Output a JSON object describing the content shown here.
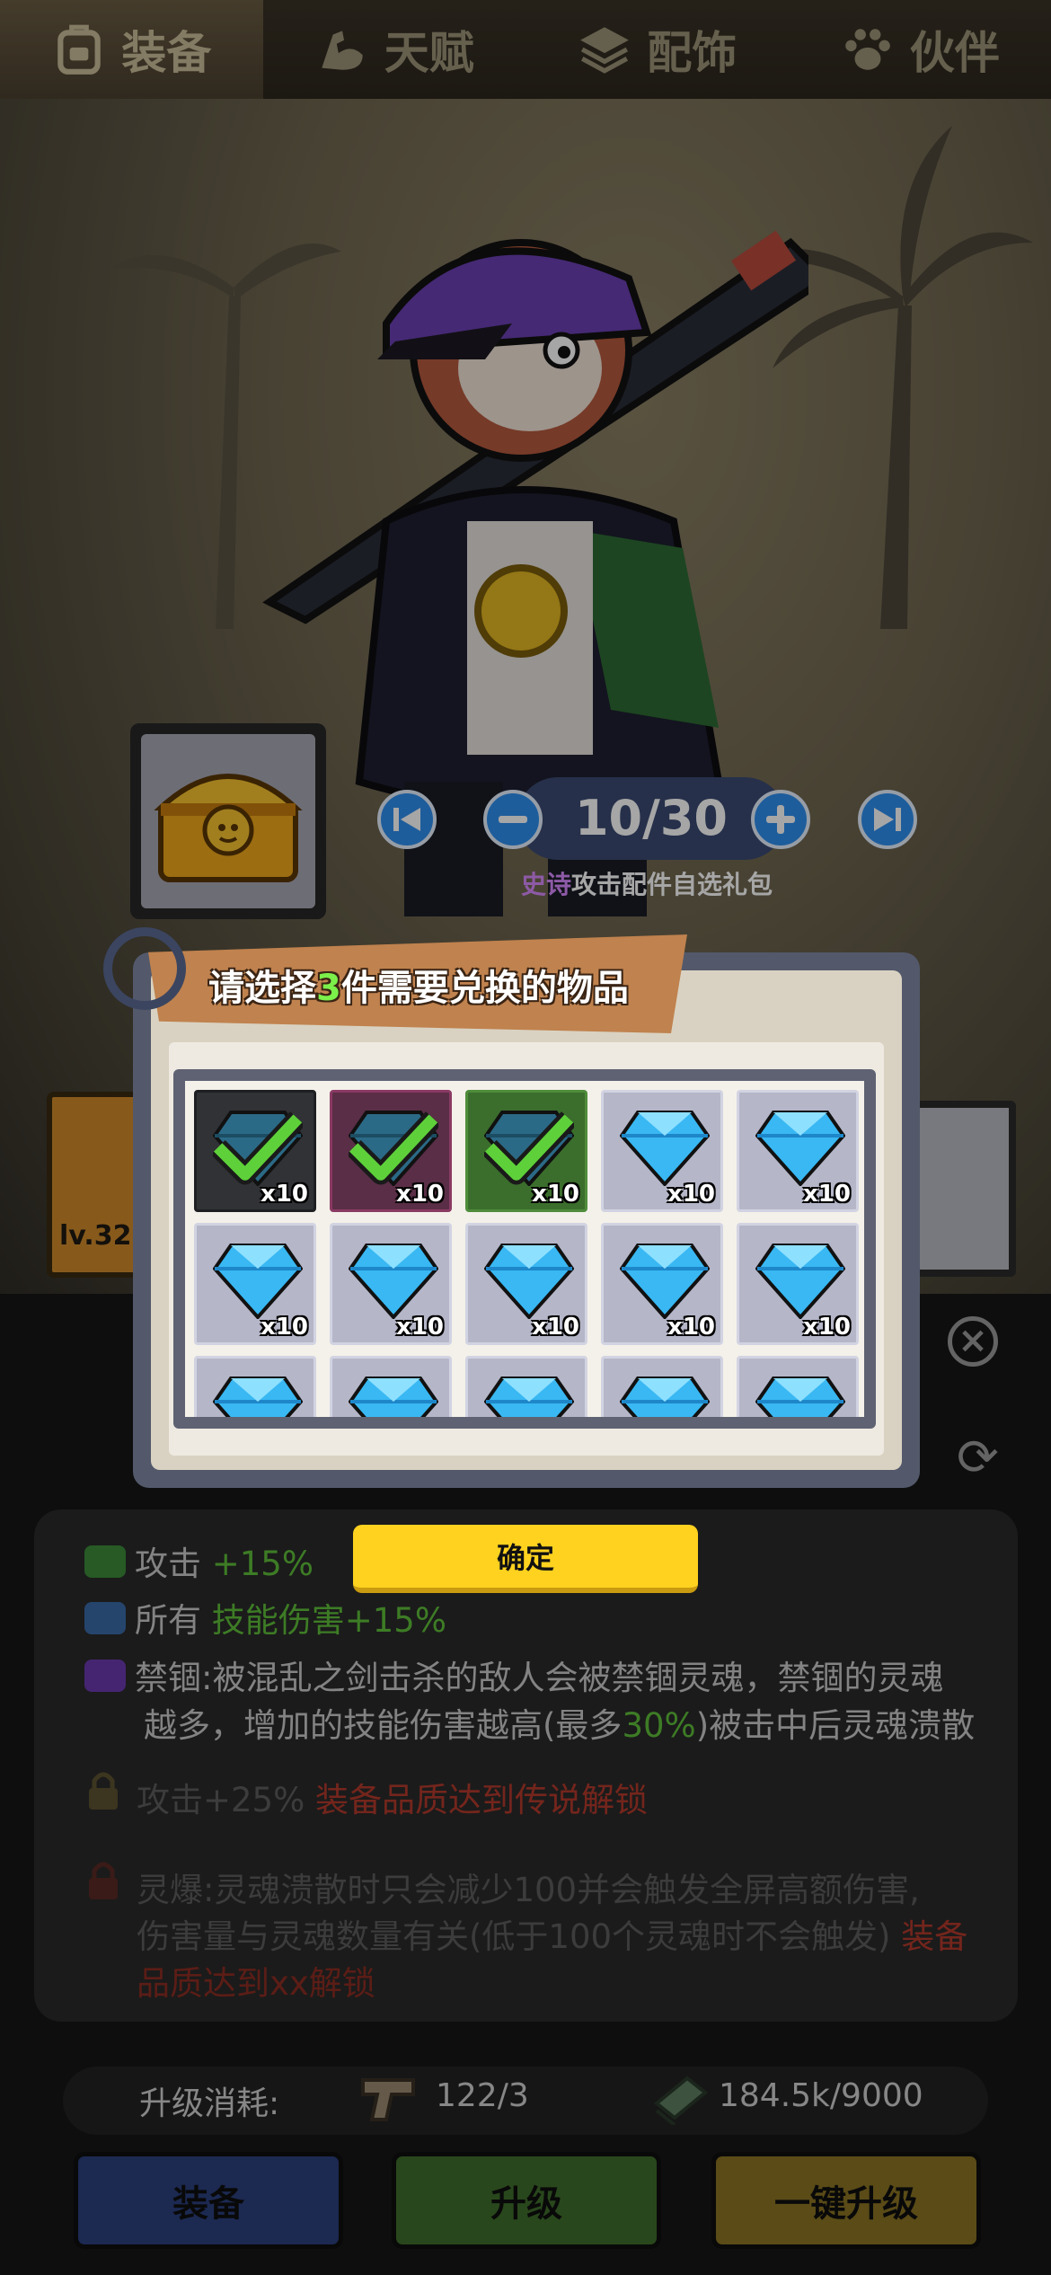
{
  "tabs": [
    {
      "label": "装备",
      "icon": "backpack-icon",
      "active": true
    },
    {
      "label": "天赋",
      "icon": "muscle-arm-icon",
      "active": false
    },
    {
      "label": "配饰",
      "icon": "layers-icon",
      "active": false
    },
    {
      "label": "伙伴",
      "icon": "paw-icon",
      "active": false
    }
  ],
  "item_pack": {
    "counter": "10/30",
    "quality": "史诗",
    "title_rest": "攻击配件自选礼包"
  },
  "popup": {
    "title_prefix": "请选择",
    "title_count": "3",
    "title_suffix": "件需要兑换的物品",
    "items": [
      {
        "qty": "x10",
        "selected": true
      },
      {
        "qty": "x10",
        "selected": true
      },
      {
        "qty": "x10",
        "selected": true
      },
      {
        "qty": "x10",
        "selected": false
      },
      {
        "qty": "x10",
        "selected": false
      },
      {
        "qty": "x10",
        "selected": false
      },
      {
        "qty": "x10",
        "selected": false
      },
      {
        "qty": "x10",
        "selected": false
      },
      {
        "qty": "x10",
        "selected": false
      },
      {
        "qty": "x10",
        "selected": false
      },
      {
        "qty": "",
        "selected": false
      },
      {
        "qty": "",
        "selected": false
      },
      {
        "qty": "",
        "selected": false
      },
      {
        "qty": "",
        "selected": false
      },
      {
        "qty": "",
        "selected": false
      }
    ],
    "confirm_label": "确定"
  },
  "equipment": {
    "level_label": "lv.32"
  },
  "attributes": {
    "attack": {
      "label": "攻击",
      "value": "+15%"
    },
    "all_skill": {
      "label": "所有",
      "value": "技能伤害+15%"
    },
    "seal_line1": "禁锢:被混乱之剑击杀的敌人会被禁锢灵魂，禁锢的灵魂",
    "seal_line2a": "越多，增加的技能伤害越高(最多",
    "seal_line2b": "30%",
    "seal_line2c": ")被击中后灵魂溃散",
    "locked1_a": "攻击+25%",
    "locked1_b": "装备品质达到传说解锁",
    "locked2_line1": "灵爆:灵魂溃散时只会减少100并会触发全屏高额伤害,",
    "locked2_line2a": "伤害量与灵魂数量有关(低于100个灵魂时不会触发)",
    "locked2_line2b": "装备",
    "locked2_line3": "品质达到xx解锁"
  },
  "upgrade_cost": {
    "label": "升级消耗:",
    "material": "122/3",
    "cash": "184.5k/9000"
  },
  "buttons": {
    "equip": "装备",
    "upgrade": "升级",
    "one_click_upgrade": "一键升级"
  },
  "colors": {
    "accent_green": "#5fbf3a",
    "epic_purple": "#d98bff",
    "lock_red": "#b23a2c",
    "confirm_yellow": "#ffd21f"
  }
}
